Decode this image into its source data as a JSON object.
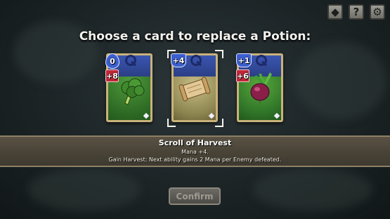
{
  "top_buttons": [
    {
      "name": "deck-button",
      "glyph": "◆"
    },
    {
      "name": "help-button",
      "glyph": "?"
    },
    {
      "name": "settings-button",
      "glyph": "⚙"
    }
  ],
  "title": "Choose a card to replace a Potion:",
  "cards": [
    {
      "name": "Broccoli",
      "mana": "0",
      "attack": "+8",
      "art": "broccoli-icon"
    },
    {
      "name": "Scroll of Harvest",
      "mana": "+4",
      "attack": "",
      "art": "scroll-icon",
      "selected": true
    },
    {
      "name": "Beet",
      "mana": "+1",
      "attack": "+6",
      "art": "beet-icon"
    }
  ],
  "info": {
    "name": "Scroll of Harvest",
    "line1": "Mana +4.",
    "line2": "Gain Harvest: Next ability gains 2 Mana per Enemy defeated."
  },
  "confirm_label": "Confirm",
  "colors": {
    "accent": "#c9b27a",
    "mana": "#3c5fd0",
    "attack": "#c0283a"
  }
}
